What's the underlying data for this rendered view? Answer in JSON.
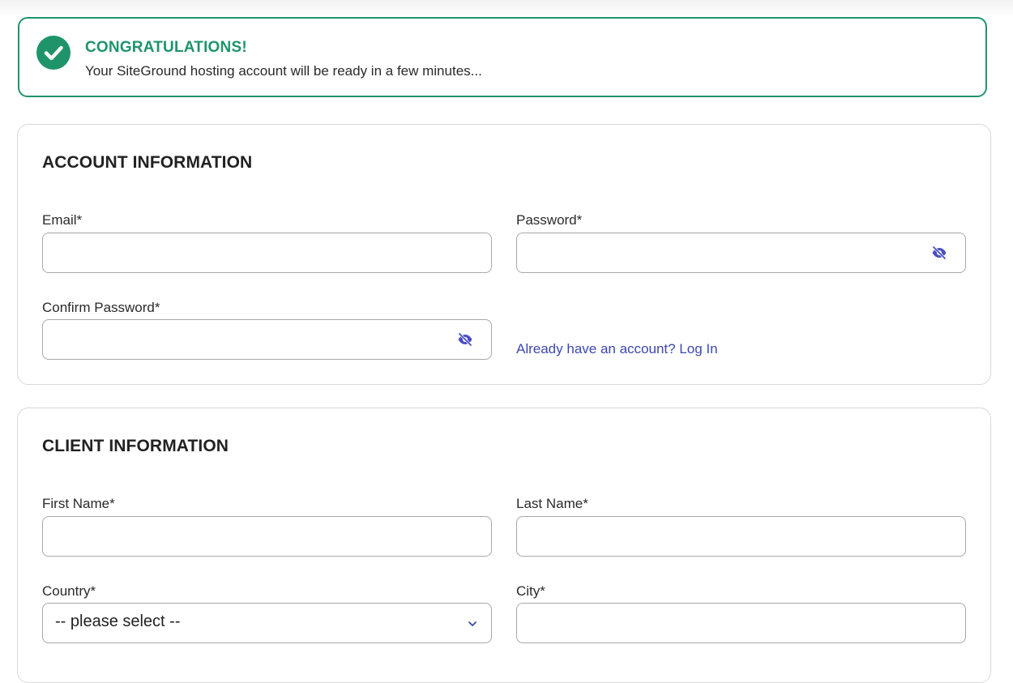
{
  "banner": {
    "title": "CONGRATULATIONS!",
    "message": "Your SiteGround hosting account will be ready in a few minutes..."
  },
  "account": {
    "heading": "ACCOUNT INFORMATION",
    "email_label": "Email*",
    "email_value": "",
    "password_label": "Password*",
    "password_value": "",
    "confirm_label": "Confirm Password*",
    "confirm_value": "",
    "login_link": "Already have an account? Log In"
  },
  "client": {
    "heading": "CLIENT INFORMATION",
    "first_name_label": "First Name*",
    "first_name_value": "",
    "last_name_label": "Last Name*",
    "last_name_value": "",
    "country_label": "Country*",
    "country_selected": "-- please select --",
    "city_label": "City*",
    "city_value": ""
  },
  "colors": {
    "success": "#1f946b",
    "link": "#3c47b0",
    "icon": "#4a4fc4"
  },
  "icons": {
    "banner": "check-circle-icon",
    "password_toggle": "eye-off-icon",
    "select": "chevron-down-icon"
  }
}
